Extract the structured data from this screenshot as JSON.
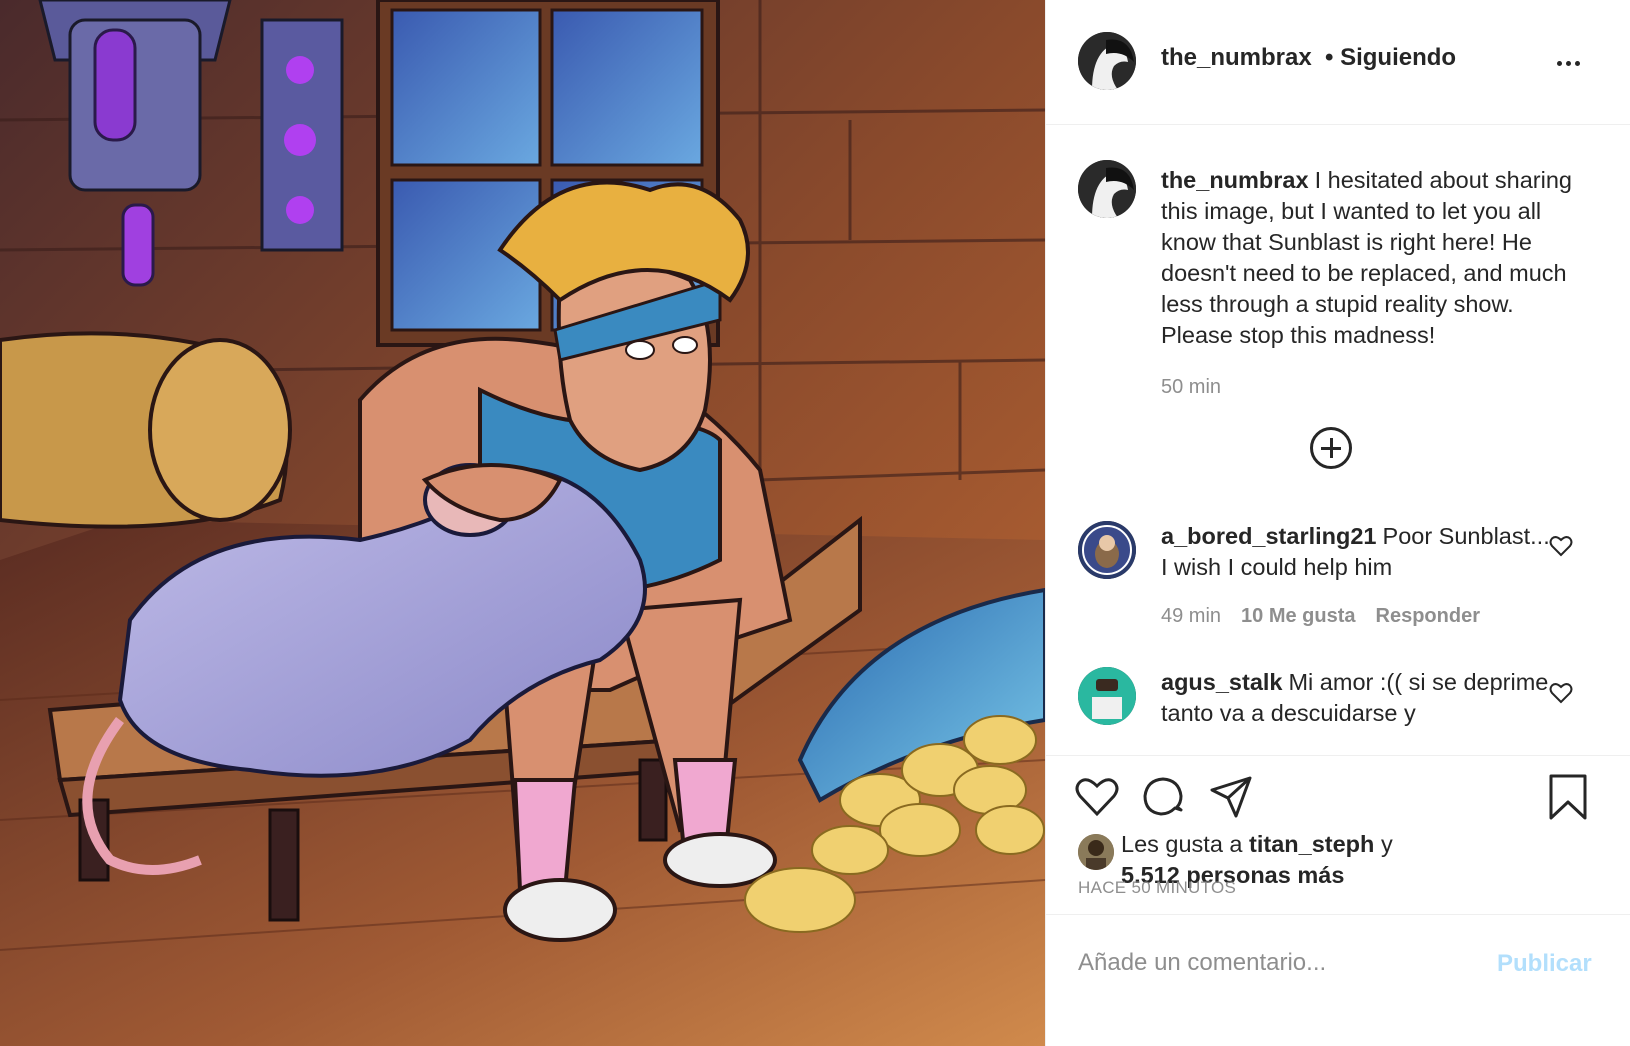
{
  "header": {
    "username": "the_numbrax",
    "separator": "•",
    "follow_status": "Siguiendo",
    "more_icon": "more-dots-icon"
  },
  "caption": {
    "username": "the_numbrax",
    "text": "I hesitated about sharing this image, but I wanted to let you all know that Sunblast is right here! He doesn't need to be replaced, and much less through a stupid reality show. Please stop this madness!",
    "time": "50 min"
  },
  "load_more_icon": "plus-circle-icon",
  "comments": [
    {
      "username": "a_bored_starling21",
      "text": "Poor Sunblast... I wish I could help him",
      "time": "49 min",
      "likes": "10 Me gusta",
      "reply": "Responder"
    },
    {
      "username": "agus_stalk",
      "text": "Mi amor :(( si se deprime tanto va a descuidarse y",
      "time": "",
      "likes": "",
      "reply": ""
    }
  ],
  "actions": {
    "icons": [
      "heart-icon",
      "comment-icon",
      "share-icon",
      "bookmark-icon"
    ]
  },
  "likes": {
    "prefix": "Les gusta a",
    "user": "titan_steph",
    "connector": "y",
    "others": "5.512 personas más"
  },
  "timeago": "HACE 50 MINUTOS",
  "comment_box": {
    "placeholder": "Añade un comentario...",
    "publish": "Publicar"
  },
  "colors": {
    "text": "#262626",
    "secondary": "#8e8e8e",
    "publish_disabled": "#b2dffc",
    "border": "#efefef"
  }
}
